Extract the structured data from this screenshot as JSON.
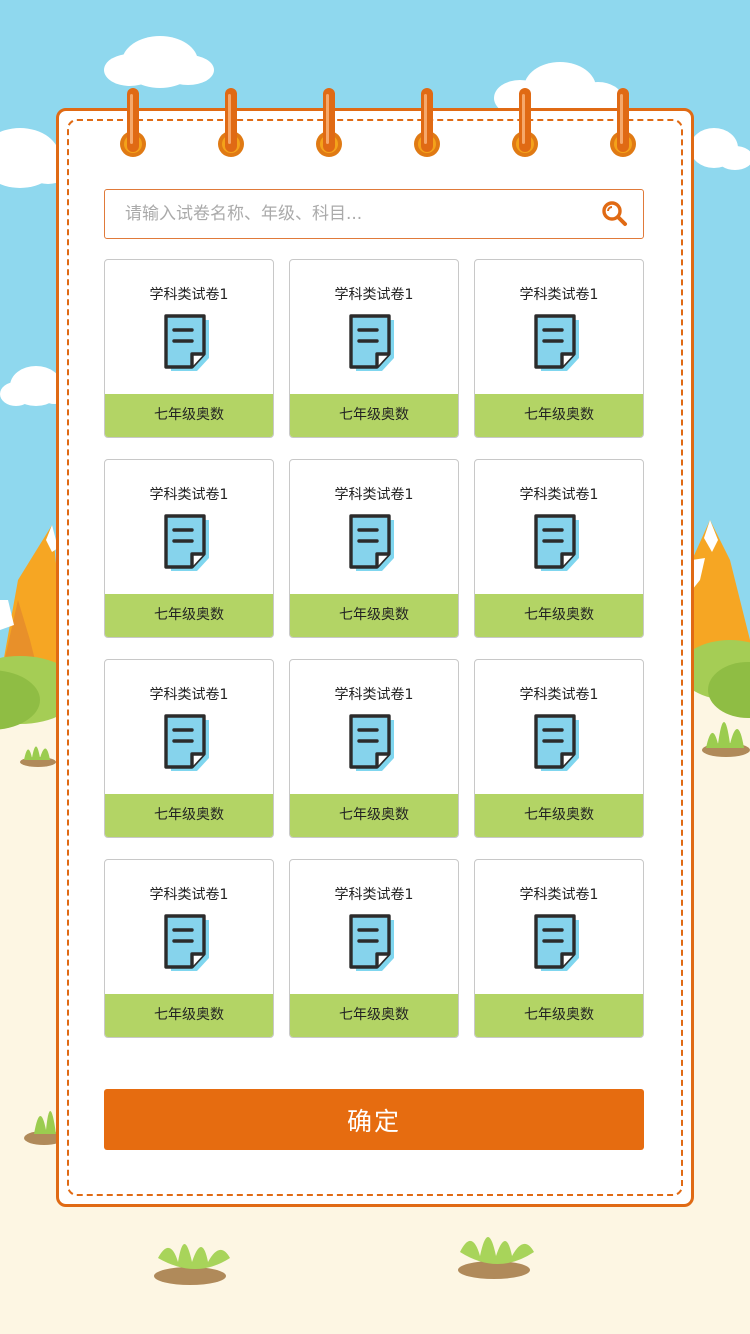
{
  "search": {
    "placeholder": "请输入试卷名称、年级、科目..."
  },
  "papers": [
    {
      "title": "学科类试卷1",
      "grade": "七年级奥数"
    },
    {
      "title": "学科类试卷1",
      "grade": "七年级奥数"
    },
    {
      "title": "学科类试卷1",
      "grade": "七年级奥数"
    },
    {
      "title": "学科类试卷1",
      "grade": "七年级奥数"
    },
    {
      "title": "学科类试卷1",
      "grade": "七年级奥数"
    },
    {
      "title": "学科类试卷1",
      "grade": "七年级奥数"
    },
    {
      "title": "学科类试卷1",
      "grade": "七年级奥数"
    },
    {
      "title": "学科类试卷1",
      "grade": "七年级奥数"
    },
    {
      "title": "学科类试卷1",
      "grade": "七年级奥数"
    },
    {
      "title": "学科类试卷1",
      "grade": "七年级奥数"
    },
    {
      "title": "学科类试卷1",
      "grade": "七年级奥数"
    },
    {
      "title": "学科类试卷1",
      "grade": "七年级奥数"
    }
  ],
  "confirm_label": "确定",
  "icons": {
    "search": "search-icon",
    "paper": "document-icon",
    "ring": "spiral-ring-icon"
  },
  "colors": {
    "sky": "#8fd8ee",
    "ground": "#fdf6e3",
    "accent": "#e66c10",
    "card_footer": "#b3d465",
    "paper_icon": "#7fd6ef"
  }
}
